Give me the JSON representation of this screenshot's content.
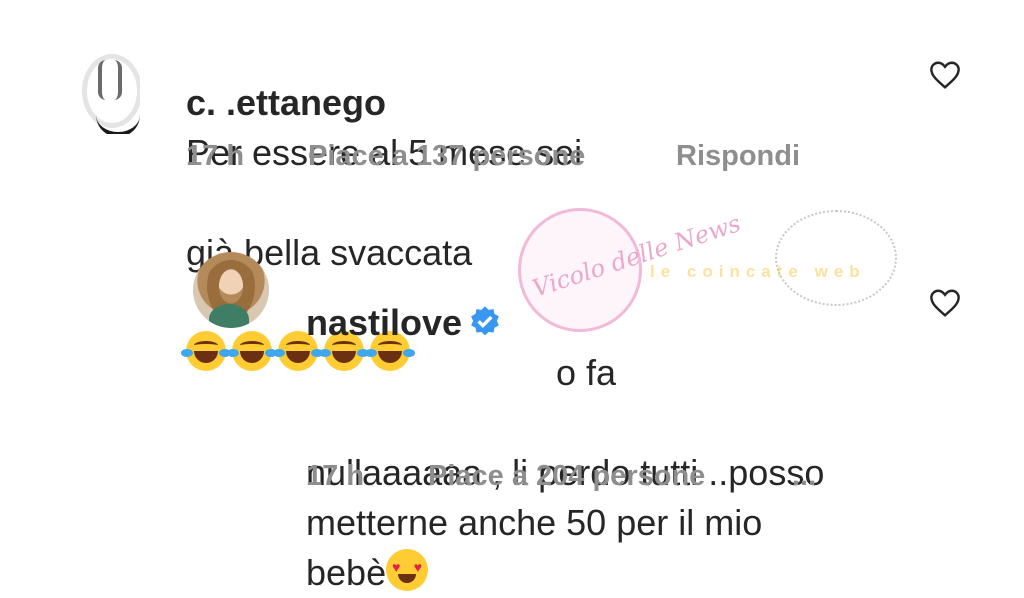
{
  "comments": [
    {
      "username": "c. .ettanego",
      "text_line1": "Per essere al 5 mese sei",
      "text_line2": "già bella svaccata",
      "emoji": "😂😂😂😂😂",
      "time": "17 h",
      "likes": "Piace a 137 persone",
      "reply": "Rispondi"
    },
    {
      "username": "nastilove",
      "verified": true,
      "text_line1": "o fa",
      "text_rest": "nullaaaaaa , li perdo tutti ..posso\nmetterne anche 50 per il mio\nbebè",
      "emoji": "😍",
      "time": "17 h",
      "likes": "Piace a 204 persone",
      "more": "..."
    }
  ],
  "watermark": {
    "text": "Vicolo delle News",
    "sub": "le coincate web"
  },
  "colors": {
    "text": "#262626",
    "meta": "#8e8e8e",
    "verified": "#3897f0"
  }
}
